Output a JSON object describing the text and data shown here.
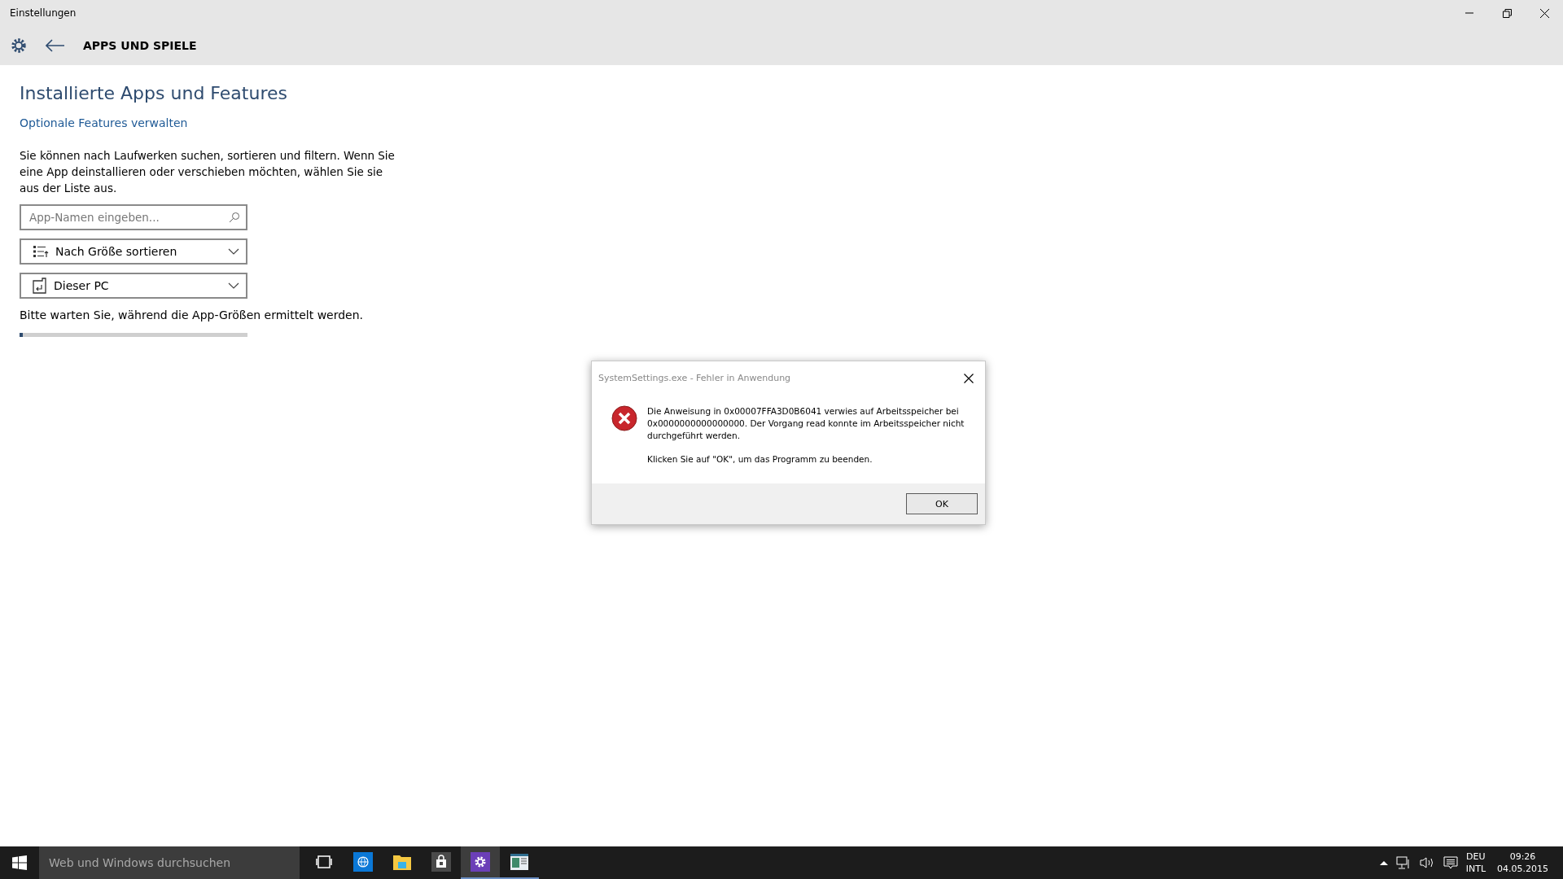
{
  "window": {
    "title": "Einstellungen",
    "page_title": "APPS UND SPIELE"
  },
  "content": {
    "heading": "Installierte Apps und Features",
    "link": "Optionale Features verwalten",
    "description": "Sie können nach Laufwerken suchen, sortieren und filtern. Wenn Sie eine App deinstallieren oder verschieben möchten, wählen Sie sie aus der Liste aus.",
    "search": {
      "placeholder": "App-Namen eingeben..."
    },
    "dropdowns": [
      {
        "kind": "sort",
        "value": "Nach Größe sortieren"
      },
      {
        "kind": "drive",
        "value": "Dieser PC"
      }
    ],
    "status": "Bitte warten Sie, während die App-Größen ermittelt werden.",
    "progress": {
      "level": 0.015
    }
  },
  "dialog": {
    "title": "SystemSettings.exe - Fehler in Anwendung",
    "message": "Die Anweisung in 0x00007FFA3D0B6041 verwies auf Arbeitsspeicher bei 0x0000000000000000. Der Vorgang read konnte im Arbeitsspeicher nicht durchgeführt werden.",
    "hint": "Klicken Sie auf \"OK\", um das Programm zu beenden.",
    "button": "OK"
  },
  "taskbar": {
    "search_placeholder": "Web und Windows durchsuchen",
    "apps": [
      {
        "kind": "taskview",
        "selected": false,
        "running": false
      },
      {
        "kind": "browser",
        "selected": false,
        "running": false
      },
      {
        "kind": "explorer",
        "selected": false,
        "running": false
      },
      {
        "kind": "store",
        "selected": false,
        "running": false
      },
      {
        "kind": "settings",
        "selected": true,
        "running": true
      },
      {
        "kind": "window",
        "selected": false,
        "running": true
      }
    ],
    "language": [
      "DEU",
      "INTL"
    ],
    "time": "09:26",
    "date": "04.05.2015"
  }
}
